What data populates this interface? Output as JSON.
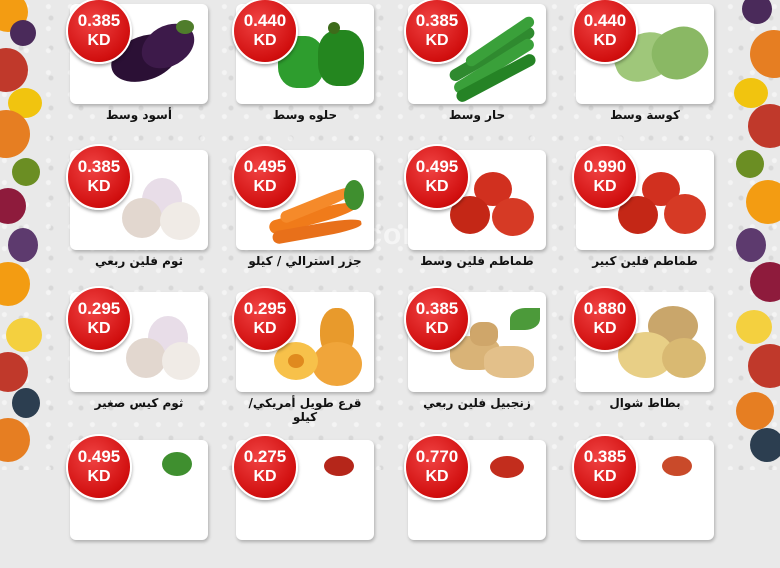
{
  "watermark": "elsrod.com",
  "currency": "KD",
  "colors": {
    "badge": "#d10f0f",
    "background": "#e9e9e9"
  },
  "products": [
    {
      "name": "أسود وسط",
      "price": "0.385",
      "icon": "eggplant-icon"
    },
    {
      "name": "حلوه وسط",
      "price": "0.440",
      "icon": "green-pepper-icon"
    },
    {
      "name": "حار وسط",
      "price": "0.385",
      "icon": "chili-pepper-icon"
    },
    {
      "name": "كوسة وسط",
      "price": "0.440",
      "icon": "zucchini-icon"
    },
    {
      "name": "ثوم فلين ربعي",
      "price": "0.385",
      "icon": "garlic-icon"
    },
    {
      "name": "جزر استرالي / كيلو",
      "price": "0.495",
      "icon": "carrot-icon"
    },
    {
      "name": "طماطم فلين وسط",
      "price": "0.495",
      "icon": "tomato-icon"
    },
    {
      "name": "طماطم فلين كبير",
      "price": "0.990",
      "icon": "tomato-icon"
    },
    {
      "name": "ثوم كيس صغير",
      "price": "0.295",
      "icon": "garlic-icon"
    },
    {
      "name": "قرع طويل أمريكي/ كيلو",
      "price": "0.295",
      "icon": "butternut-squash-icon"
    },
    {
      "name": "زنجبيل فلين ربعي",
      "price": "0.385",
      "icon": "ginger-icon"
    },
    {
      "name": "بطاط شوال",
      "price": "0.880",
      "icon": "potato-icon"
    },
    {
      "name": "",
      "price": "0.495",
      "icon": "herbs-icon"
    },
    {
      "name": "",
      "price": "0.275",
      "icon": "red-pepper-icon"
    },
    {
      "name": "",
      "price": "0.770",
      "icon": "red-pepper-icon"
    },
    {
      "name": "",
      "price": "0.385",
      "icon": "vegetable-icon"
    }
  ]
}
